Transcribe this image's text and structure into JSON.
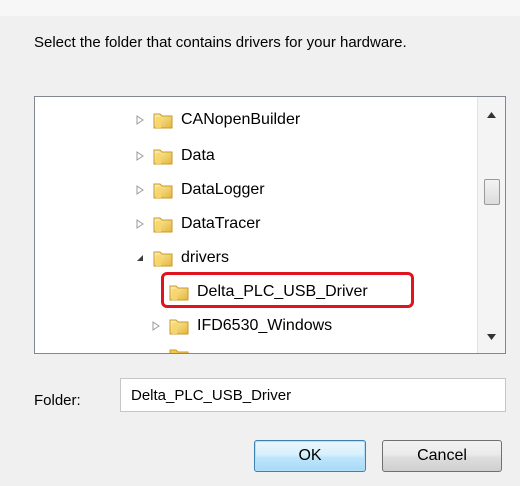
{
  "dialog": {
    "instruction": "Select the folder that contains drivers for your hardware."
  },
  "tree": {
    "items": [
      {
        "label": "CANopenBuilder",
        "expander": "collapsed",
        "level": 1
      },
      {
        "label": "Data",
        "expander": "collapsed",
        "level": 1
      },
      {
        "label": "DataLogger",
        "expander": "collapsed",
        "level": 1
      },
      {
        "label": "DataTracer",
        "expander": "collapsed",
        "level": 1
      },
      {
        "label": "drivers",
        "expander": "expanded",
        "level": 1
      },
      {
        "label": "Delta_PLC_USB_Driver",
        "expander": "none",
        "level": 2,
        "selected": true
      },
      {
        "label": "IFD6530_Windows",
        "expander": "collapsed",
        "level": 2
      }
    ],
    "highlight_color": "#e0141e"
  },
  "folder_field": {
    "label": "Folder:",
    "value": "Delta_PLC_USB_Driver"
  },
  "buttons": {
    "ok": "OK",
    "cancel": "Cancel"
  },
  "icons": {
    "folder": "folder-icon",
    "expand": "triangle-right-icon",
    "collapse": "triangle-down-icon",
    "scroll_up": "scroll-up-arrow-icon",
    "scroll_down": "scroll-down-arrow-icon"
  }
}
